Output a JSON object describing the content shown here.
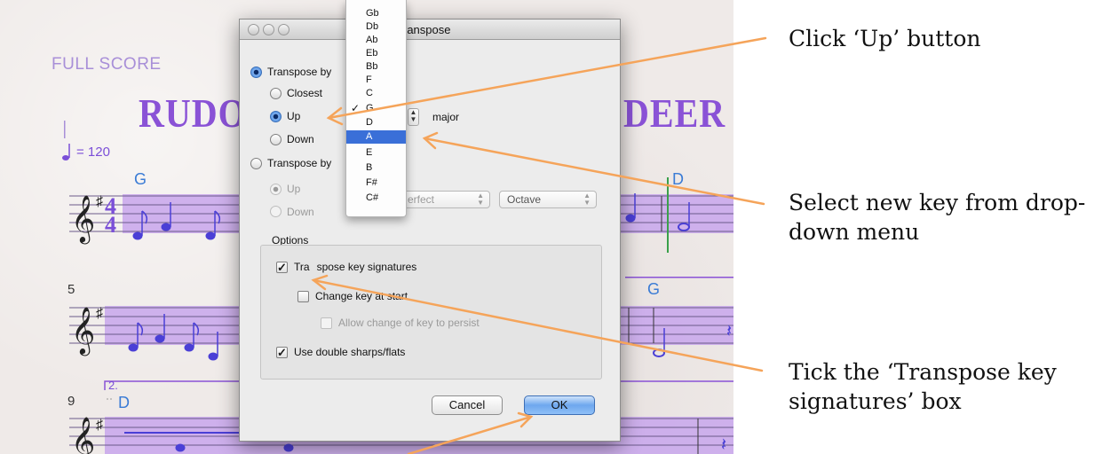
{
  "score": {
    "full_score_label": "FULL SCORE",
    "title_left": "RUDOLI",
    "title_right": "DEER",
    "tempo": "= 120",
    "chord_g1": "G",
    "chord_d1": "D",
    "chord_g2": "G",
    "chord_d2": "D",
    "bar5": "5",
    "bar9": "9",
    "ending": "2."
  },
  "dialog": {
    "title": "ranspose",
    "transpose_by_key": "Transpose by",
    "closest": "Closest",
    "up": "Up",
    "down": "Down",
    "major": "major",
    "transpose_by_interval": "Transpose by",
    "interval_up": "Up",
    "interval_down": "Down",
    "perfect": "erfect",
    "octave": "Octave",
    "options_heading": "Options",
    "transpose_key_sigs_a": "Tra",
    "transpose_key_sigs_b": "spose key signatures",
    "change_key_a": "Change key at star",
    "change_key_b": "t",
    "allow_change": "Allow change of key to persist",
    "double_sharps": "Use double sharps/flats",
    "cancel": "Cancel",
    "ok": "OK"
  },
  "key_menu": {
    "items": [
      "Gb",
      "Db",
      "Ab",
      "Eb",
      "Bb",
      "F",
      "C",
      "G",
      "D",
      "A",
      "E",
      "B",
      "F#",
      "C#"
    ],
    "checked": "G",
    "highlighted": "A"
  },
  "annotations": {
    "up_line1": "Click ‘Up’ button",
    "select_line1": "Select new key from drop-",
    "select_line2": "down menu",
    "tick_line1": "Tick the ‘Transpose key",
    "tick_line2": "signatures’ box"
  },
  "colors": {
    "arrow": "#f5a45a",
    "staff_highlight": "#c8a6ec",
    "notes": "#4a3fd6",
    "chords": "#3a7bd5",
    "menu_highlight": "#3a6fd8"
  }
}
